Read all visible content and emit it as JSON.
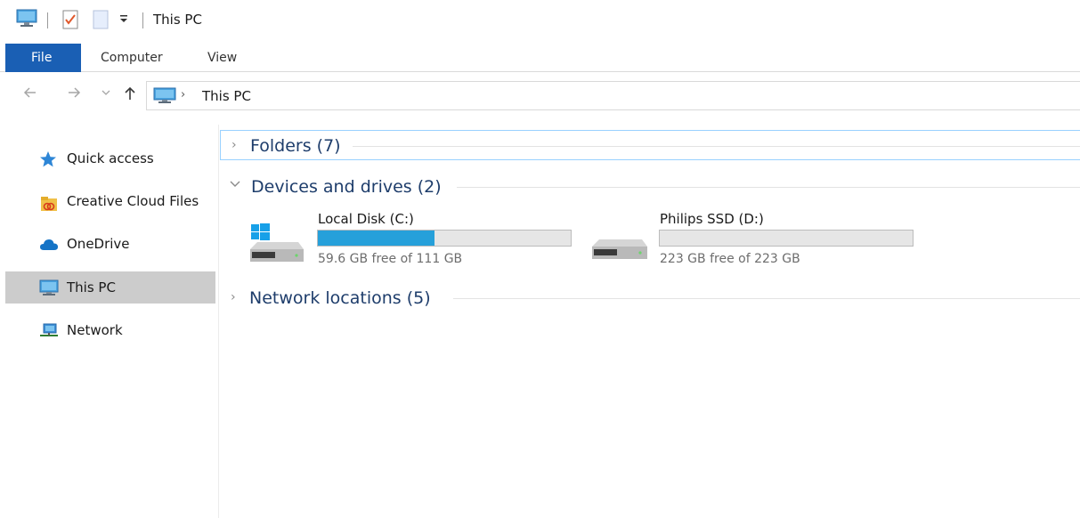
{
  "window": {
    "title": "This PC"
  },
  "titlebar": {
    "quick_access_icons": [
      "computer-icon",
      "properties-icon",
      "new-folder-icon",
      "customize-quick-access-dropdown-icon"
    ]
  },
  "ribbon": {
    "tabs": [
      {
        "label": "File",
        "active": true
      },
      {
        "label": "Computer",
        "active": false
      },
      {
        "label": "View",
        "active": false
      }
    ]
  },
  "address": {
    "back_icon": "arrow-left-icon",
    "forward_icon": "arrow-right-icon",
    "recent_icon": "chevron-down-icon",
    "up_icon": "arrow-up-icon",
    "location_icon": "this-pc-icon",
    "path": "This PC"
  },
  "sidebar": {
    "items": [
      {
        "label": "Quick access",
        "icon": "star-icon",
        "selected": false
      },
      {
        "label": "Creative Cloud Files",
        "icon": "creative-cloud-folder-icon",
        "selected": false
      },
      {
        "label": "OneDrive",
        "icon": "cloud-icon",
        "selected": false
      },
      {
        "label": "This PC",
        "icon": "monitor-icon",
        "selected": true
      },
      {
        "label": "Network",
        "icon": "network-icon",
        "selected": false
      }
    ]
  },
  "content": {
    "groups": [
      {
        "title": "Folders (7)",
        "expanded": false
      },
      {
        "title": "Devices and drives (2)",
        "expanded": true
      },
      {
        "title": "Network locations (5)",
        "expanded": false
      }
    ],
    "drives": [
      {
        "name": "Local Disk (C:)",
        "free_text": "59.6 GB free of 111 GB",
        "used_fraction": 0.46,
        "icon": "windows-drive-icon"
      },
      {
        "name": "Philips SSD (D:)",
        "free_text": "223 GB free of 223 GB",
        "used_fraction": 0.0,
        "icon": "drive-icon"
      }
    ]
  },
  "colors": {
    "accent": "#1a5fb4",
    "progress_fill": "#26a0da",
    "selection": "#cccccc",
    "group_title": "#1e3d6b"
  }
}
